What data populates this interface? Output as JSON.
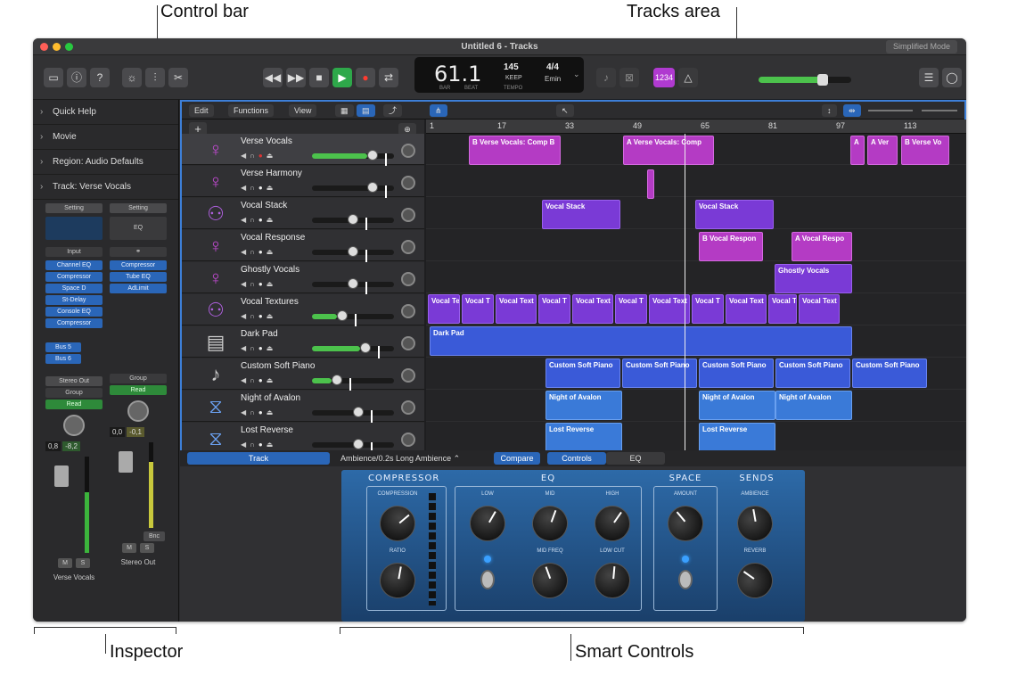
{
  "callouts": {
    "control_bar": "Control bar",
    "tracks_area": "Tracks area",
    "inspector": "Inspector",
    "smart_controls": "Smart Controls"
  },
  "window": {
    "title": "Untitled 6 - Tracks",
    "simplified": "Simplified Mode"
  },
  "lcd": {
    "position": "61.1",
    "bar": "BAR",
    "beat": "BEAT",
    "tempo_val": "145",
    "keep": "KEEP",
    "tempo": "TEMPO",
    "sig": "4/4",
    "key": "Emin"
  },
  "toolbar": {
    "badge": "1234"
  },
  "inspector": {
    "rows": [
      {
        "label": "Quick Help"
      },
      {
        "label": "Movie"
      },
      {
        "label": "Region: Audio Defaults"
      },
      {
        "label": "Track:  Verse Vocals"
      }
    ],
    "ch1": {
      "setting": "Setting",
      "input": "Input",
      "plugins": [
        "Channel EQ",
        "Compressor",
        "Space D",
        "St-Delay",
        "Console EQ",
        "Compressor"
      ],
      "sends": [
        "Bus 5",
        "Bus 6"
      ],
      "output": "Stereo Out",
      "group": "Group",
      "auto": "Read",
      "val1": "0,8",
      "val2": "-8,2",
      "m": "M",
      "s": "S",
      "name": "Verse Vocals"
    },
    "ch2": {
      "setting": "Setting",
      "eq": "EQ",
      "plugins": [
        "Compressor",
        "Tube EQ",
        "AdLimit"
      ],
      "group": "Group",
      "auto": "Read",
      "val1": "0,0",
      "val2": "-0,1",
      "bnc": "Bnc",
      "m": "M",
      "s": "S",
      "name": "Stereo Out"
    }
  },
  "tracks_menu": {
    "edit": "Edit",
    "functions": "Functions",
    "view": "View"
  },
  "ruler": [
    "1",
    "17",
    "33",
    "49",
    "65",
    "81",
    "97",
    "113"
  ],
  "tracks": [
    {
      "name": "Verse Vocals",
      "icon": "person-icon",
      "color": "#c04ad0"
    },
    {
      "name": "Verse Harmony",
      "icon": "person-icon",
      "color": "#c04ad0"
    },
    {
      "name": "Vocal Stack",
      "icon": "group-icon",
      "color": "#b060e0"
    },
    {
      "name": "Vocal Response",
      "icon": "person-icon",
      "color": "#c04ad0"
    },
    {
      "name": "Ghostly Vocals",
      "icon": "person-icon",
      "color": "#c04ad0"
    },
    {
      "name": "Vocal Textures",
      "icon": "group-icon",
      "color": "#b060e0"
    },
    {
      "name": "Dark Pad",
      "icon": "keyboard-icon",
      "color": "#ccc"
    },
    {
      "name": "Custom Soft Piano",
      "icon": "piano-icon",
      "color": "#ccc"
    },
    {
      "name": "Night of Avalon",
      "icon": "synth-icon",
      "color": "#6aa0f0"
    },
    {
      "name": "Lost Reverse",
      "icon": "synth-icon",
      "color": "#6aa0f0"
    }
  ],
  "regions": {
    "r1": "B  Verse Vocals: Comp B",
    "r2": "A  Verse Vocals: Comp",
    "r3": "A",
    "r4": "A  Ver",
    "r5": "B  Verse Vo",
    "stack1": "Vocal Stack",
    "stack2": "Vocal Stack",
    "resp1": "B  Vocal Respon",
    "resp2": "A  Vocal Respo",
    "ghost": "Ghostly Vocals",
    "tex": [
      "Vocal Te",
      "Vocal T",
      "Vocal Text",
      "Vocal T",
      "Vocal Text",
      "Vocal T",
      "Vocal Text",
      "Vocal T",
      "Vocal Text",
      "Vocal T",
      "Vocal Text"
    ],
    "pad": "Dark Pad",
    "piano": [
      "Custom Soft Piano",
      "Custom Soft Piano",
      "Custom Soft Piano",
      "Custom Soft Piano",
      "Custom Soft Piano"
    ],
    "avalon": [
      "Night of Avalon",
      "Night of Avalon",
      "Night of Avalon"
    ],
    "lost": [
      "Lost Reverse",
      "Lost Reverse"
    ]
  },
  "smart_bar": {
    "track": "Track",
    "preset": "Ambience/0.2s Long Ambience",
    "compare": "Compare",
    "controls": "Controls",
    "eq": "EQ"
  },
  "panel": {
    "compressor": "COMPRESSOR",
    "compression": "COMPRESSION",
    "ratio": "RATIO",
    "eq": "EQ",
    "low": "LOW",
    "mid": "MID",
    "high": "HIGH",
    "mid_freq": "MID FREQ",
    "low_cut": "LOW CUT",
    "space": "SPACE",
    "amount": "AMOUNT",
    "sends": "SENDS",
    "ambience": "AMBIENCE",
    "reverb": "REVERB"
  }
}
